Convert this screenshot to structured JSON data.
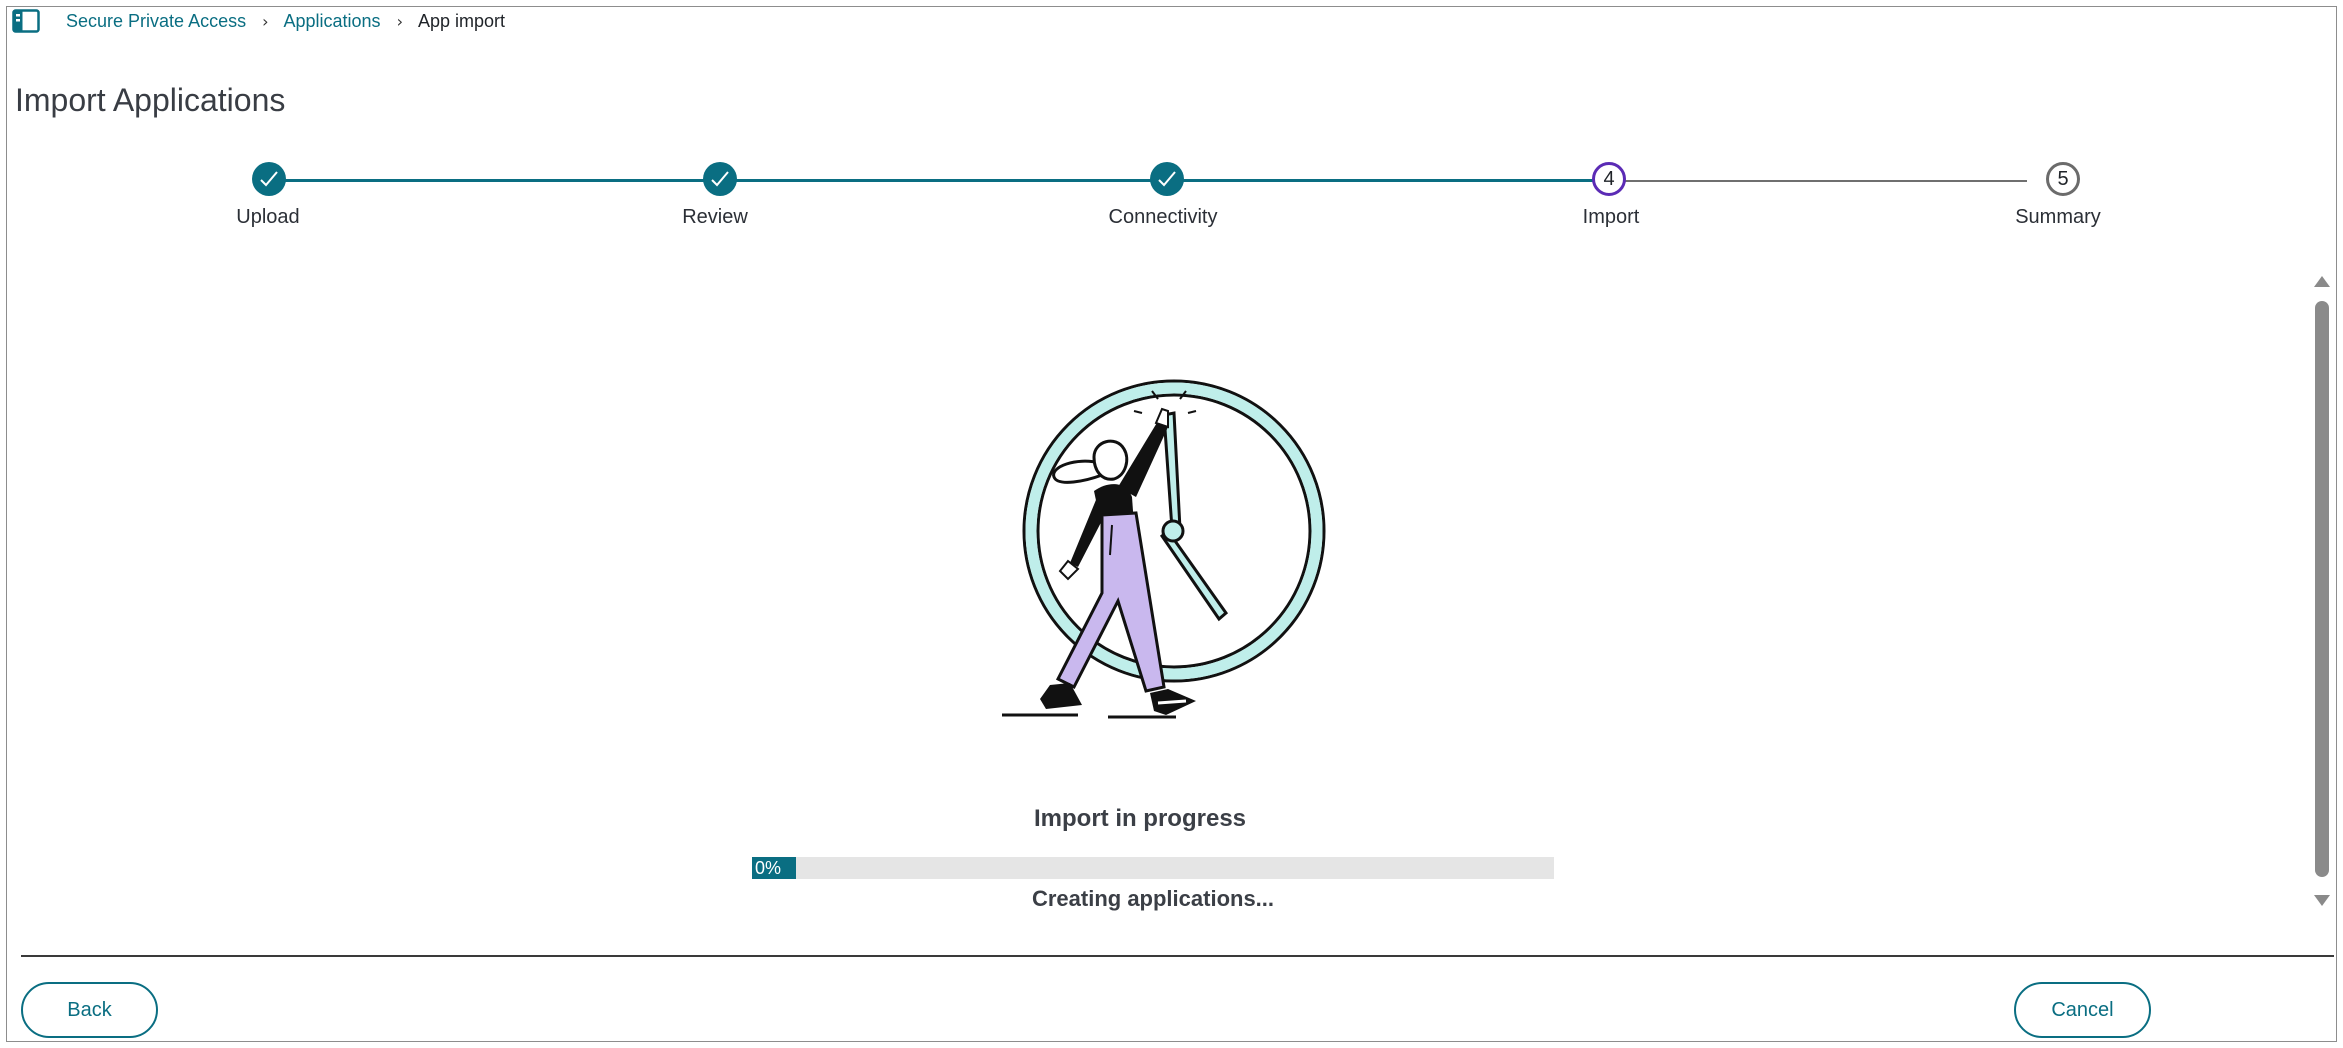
{
  "breadcrumb": {
    "items": [
      {
        "label": "Secure Private Access"
      },
      {
        "label": "Applications"
      },
      {
        "label": "App import"
      }
    ]
  },
  "page": {
    "title": "Import Applications"
  },
  "stepper": {
    "steps": [
      {
        "label": "Upload",
        "number": "1",
        "state": "done"
      },
      {
        "label": "Review",
        "number": "2",
        "state": "done"
      },
      {
        "label": "Connectivity",
        "number": "3",
        "state": "done"
      },
      {
        "label": "Import",
        "number": "4",
        "state": "current"
      },
      {
        "label": "Summary",
        "number": "5",
        "state": "pending"
      }
    ]
  },
  "progress": {
    "title": "Import in progress",
    "percent_text": "0%",
    "percent": 0,
    "status": "Creating applications..."
  },
  "footer": {
    "back_label": "Back",
    "cancel_label": "Cancel"
  },
  "colors": {
    "accent": "#0a6e82",
    "current_step": "#5b2bb5",
    "illustration_teal": "#bfeeea",
    "illustration_lavender": "#c9b8ee"
  }
}
